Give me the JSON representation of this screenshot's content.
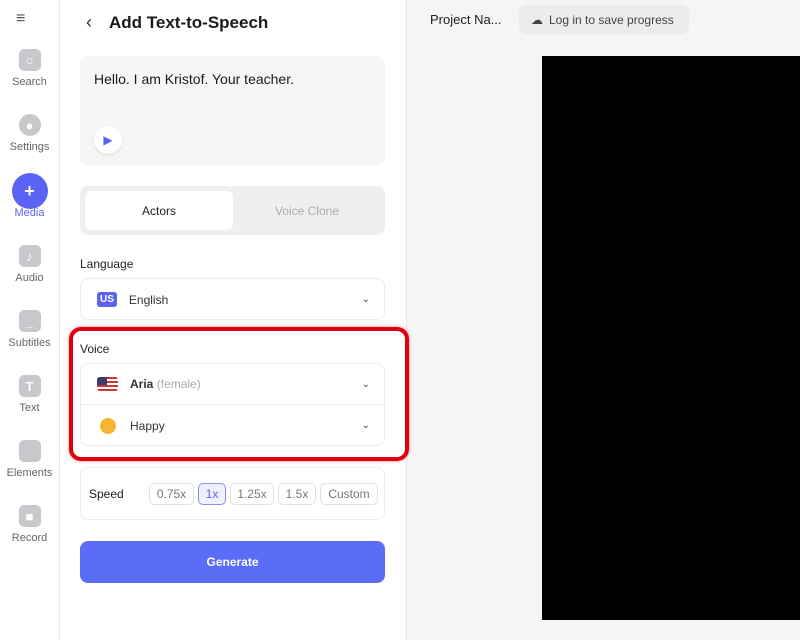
{
  "sidebar": {
    "items": [
      {
        "label": "Search",
        "icon": "search-icon"
      },
      {
        "label": "Settings",
        "icon": "settings-icon"
      },
      {
        "label": "Media",
        "icon": "plus-icon",
        "active": true
      },
      {
        "label": "Audio",
        "icon": "music-note-icon"
      },
      {
        "label": "Subtitles",
        "icon": "subtitles-icon"
      },
      {
        "label": "Text",
        "icon": "text-icon"
      },
      {
        "label": "Elements",
        "icon": "elements-icon"
      },
      {
        "label": "Record",
        "icon": "video-camera-icon"
      }
    ]
  },
  "panel": {
    "title": "Add Text-to-Speech",
    "text": "Hello. I am Kristof. Your teacher.",
    "tabs": [
      "Actors",
      "Voice Clone"
    ],
    "active_tab": "Actors",
    "language_label": "Language",
    "language_badge": "US",
    "language": "English",
    "voice_label": "Voice",
    "voice_name": "Aria",
    "voice_gender": "(female)",
    "emotion": "Happy",
    "speed_label": "Speed",
    "speeds": [
      "0.75x",
      "1x",
      "1.25x",
      "1.5x",
      "Custom"
    ],
    "selected_speed": "1x",
    "generate": "Generate"
  },
  "header": {
    "project_name": "Project Na...",
    "login": "Log in to save progress"
  },
  "colors": {
    "accent": "#5b63f5",
    "highlight": "#e0000d"
  }
}
